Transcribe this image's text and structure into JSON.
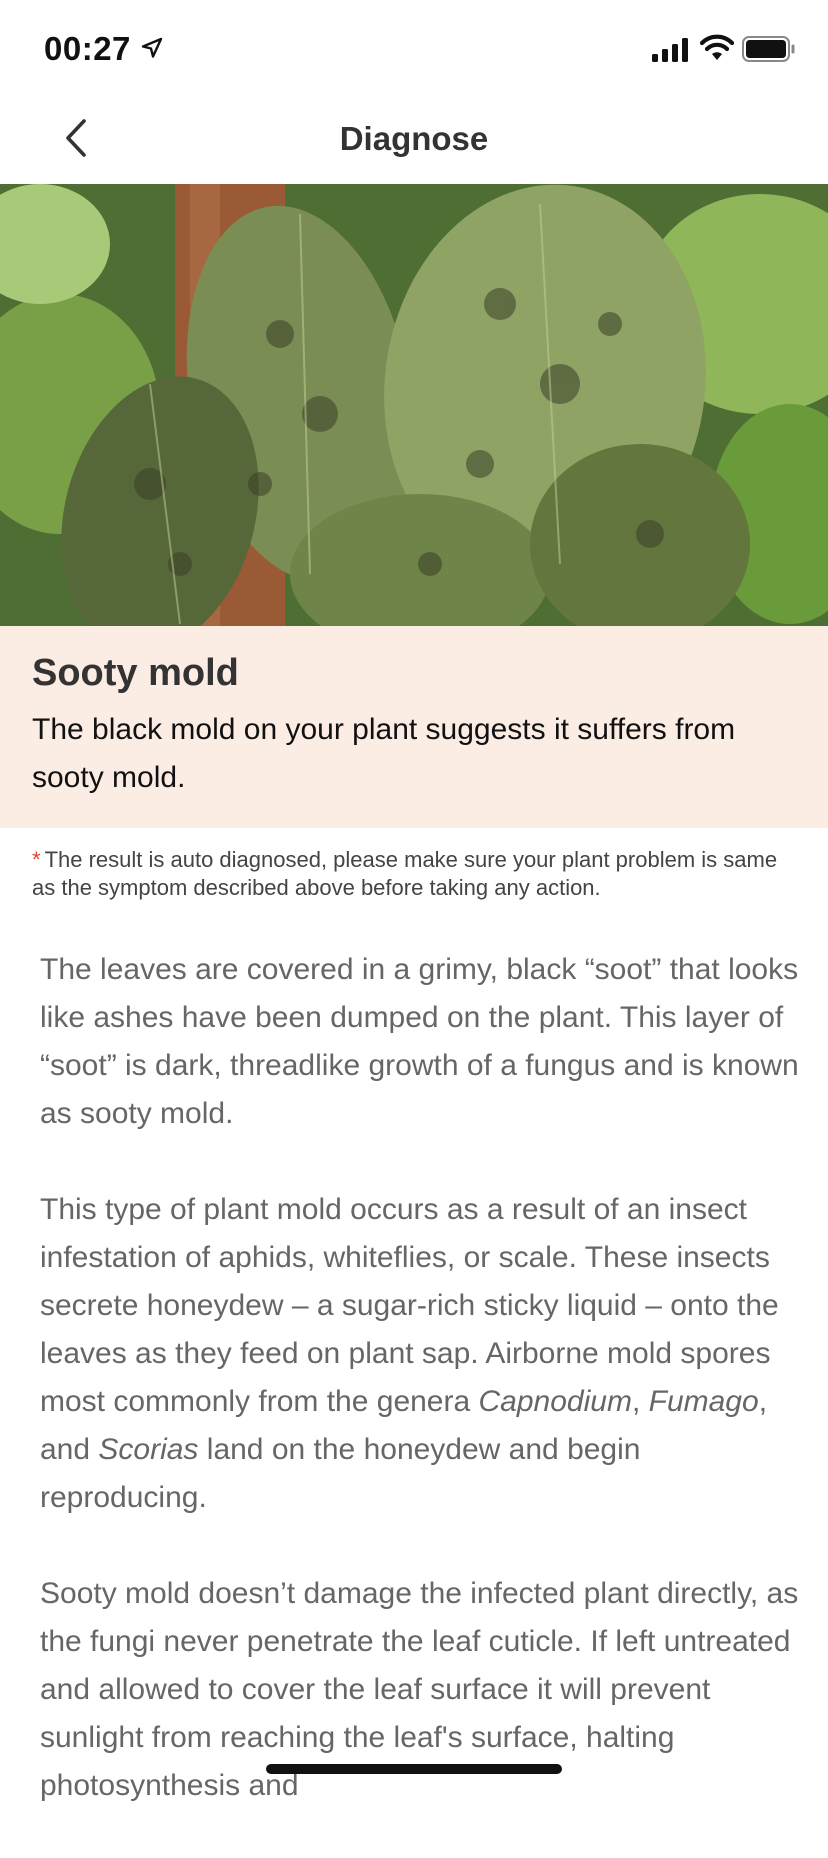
{
  "status_bar": {
    "time": "00:27"
  },
  "nav": {
    "title": "Diagnose"
  },
  "result": {
    "title": "Sooty mold",
    "summary": "The black mold on your plant suggests it suffers from sooty mold."
  },
  "disclaimer": {
    "marker": "*",
    "text": "The result is auto diagnosed, please make sure your plant problem is same as the symptom described above before taking any action."
  },
  "body": {
    "p1": "The leaves are covered in a grimy, black “soot” that looks like ashes have been dumped on the plant. This layer of “soot” is dark, threadlike growth of a fungus and is known as sooty mold.",
    "p2": {
      "a": "This type of plant mold occurs as a result of an insect infestation of aphids, whiteflies, or scale. These insects secrete honeydew – a sugar-rich sticky liquid – onto the leaves as they feed on plant sap. Airborne mold spores most commonly from the genera ",
      "genus1": "Capnodium",
      "sep1": ", ",
      "genus2": "Fumago",
      "sep2": ", and ",
      "genus3": "Scorias",
      "b": " land on the honeydew and begin reproducing."
    },
    "p3": "Sooty mold doesn’t damage the infected plant directly, as the fungi never penetrate the leaf cuticle. If left untreated and allowed to cover the leaf surface it will prevent sunlight from reaching the leaf's surface, halting photosynthesis and"
  },
  "icons": {
    "location": "location-arrow-icon",
    "signal": "cellular-signal-icon",
    "wifi": "wifi-icon",
    "battery": "battery-icon",
    "back": "chevron-left-icon"
  },
  "colors": {
    "result_card_bg": "#fbece4",
    "asterisk": "#e0453a",
    "body_text": "#666666"
  }
}
